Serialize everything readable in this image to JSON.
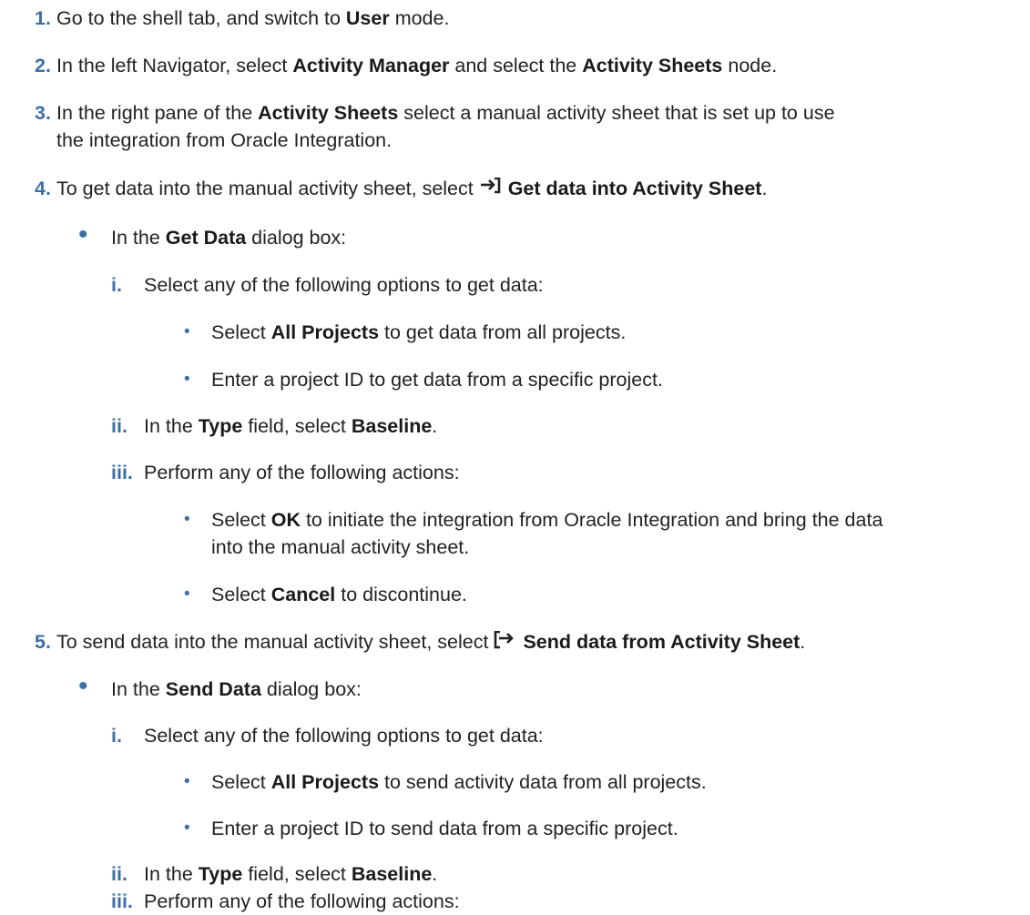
{
  "colors": {
    "accent": "#3d6fa6",
    "text": "#222222"
  },
  "icons": {
    "get_data": "arrow-into-bracket-icon",
    "send_data": "arrow-out-of-bracket-icon"
  },
  "steps": [
    {
      "num": "1.",
      "t1": "Go to the shell tab, and switch to ",
      "b1": "User",
      "t2": " mode."
    },
    {
      "num": "2.",
      "t1": "In the left Navigator, select ",
      "b1": "Activity Manager",
      "t2": " and select the ",
      "b2": "Activity Sheets",
      "t3": " node."
    },
    {
      "num": "3.",
      "t1": "In the right pane of the ",
      "b1": "Activity Sheets",
      "t2": " select a manual activity sheet that is set up to use",
      "line2": "the integration from Oracle Integration."
    },
    {
      "num": "4.",
      "t1": "To get data into the manual activity sheet, select ",
      "b1": "Get data into Activity Sheet",
      "t2": "."
    },
    {
      "num": "5.",
      "t1": "To send data into the manual activity sheet, select ",
      "b1": "Send data from Activity Sheet",
      "t2": "."
    }
  ],
  "get": {
    "bullet": "•",
    "intro": {
      "t1": "In the ",
      "b1": "Get Data",
      "t2": " dialog box:"
    },
    "i": {
      "num": "i.",
      "text": "Select any of the following options to get data:"
    },
    "i_a": {
      "t1": "Select ",
      "b1": "All Projects",
      "t2": " to get data from all projects."
    },
    "i_b": {
      "text": "Enter a project ID to get data from a specific project."
    },
    "ii": {
      "num": "ii.",
      "t1": "In the ",
      "b1": "Type",
      "t2": " field, select ",
      "b2": "Baseline",
      "t3": "."
    },
    "iii": {
      "num": "iii.",
      "text": "Perform any of the following actions:"
    },
    "iii_a": {
      "t1": "Select ",
      "b1": "OK",
      "t2": " to initiate the integration from Oracle Integration and bring the data",
      "line2": "into the manual activity sheet."
    },
    "iii_b": {
      "t1": "Select ",
      "b1": "Cancel",
      "t2": " to discontinue."
    }
  },
  "send": {
    "bullet": "•",
    "intro": {
      "t1": "In the ",
      "b1": "Send Data",
      "t2": " dialog box:"
    },
    "i": {
      "num": "i.",
      "text": "Select any of the following options to get data:"
    },
    "i_a": {
      "t1": "Select ",
      "b1": "All Projects",
      "t2": " to send activity data from all projects."
    },
    "i_b": {
      "text": "Enter a project ID to send data from a specific project."
    },
    "ii": {
      "num": "ii.",
      "t1": "In the ",
      "b1": "Type",
      "t2": " field, select ",
      "b2": "Baseline",
      "t3": "."
    },
    "iii": {
      "num": "iii.",
      "text": "Perform any of the following actions:"
    }
  }
}
